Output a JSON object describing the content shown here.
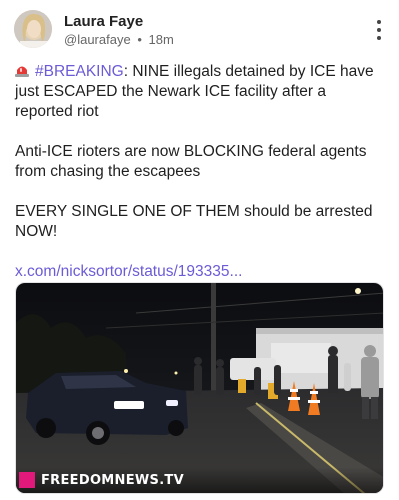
{
  "post": {
    "author": {
      "display_name": "Laura Faye",
      "handle": "@laurafaye",
      "separator": "•",
      "time_ago": "18m"
    },
    "body": {
      "hashtag": "#BREAKING",
      "line1_rest": ": NINE illegals detained by ICE have just ESCAPED the Newark ICE facility after a reported riot",
      "paragraph2": "Anti-ICE rioters are now BLOCKING federal agents from chasing the escapees",
      "paragraph3": "EVERY SINGLE ONE OF THEM should be arrested NOW!",
      "link": "x.com/nicksortor/status/193335..."
    },
    "media": {
      "watermark": "FREEDOMNEWS.TV"
    }
  },
  "colors": {
    "accent_link": "#6b5bd6",
    "watermark_brand": "#e0197a",
    "siren": "#e53935"
  },
  "icons": {
    "siren": "rotating-light-icon",
    "more": "more-vertical-icon"
  }
}
